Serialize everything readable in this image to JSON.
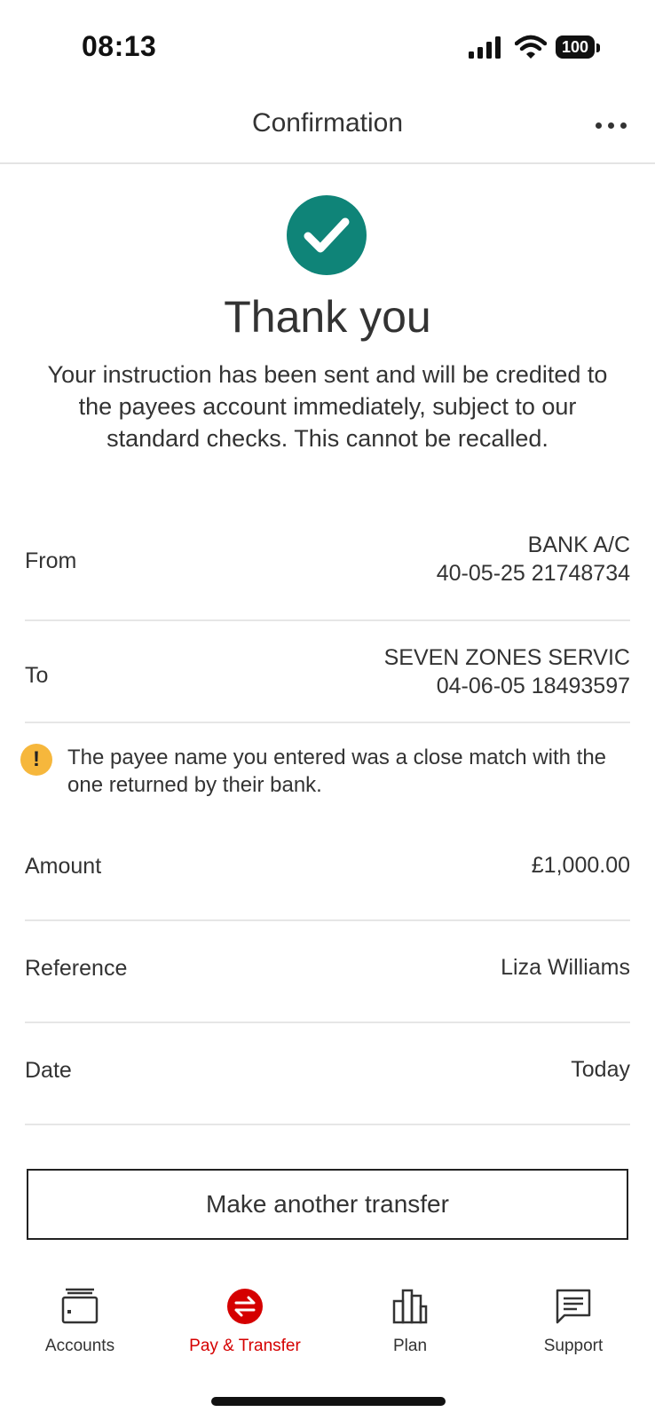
{
  "status_bar": {
    "time": "08:13",
    "battery": "100"
  },
  "header": {
    "title": "Confirmation"
  },
  "success": {
    "title": "Thank you",
    "message": "Your instruction has been sent and will be credited to the payees account immediately, subject to our standard checks.  This cannot be recalled."
  },
  "details": {
    "from": {
      "label": "From",
      "line1": "BANK A/C",
      "line2": "40-05-25 21748734"
    },
    "to": {
      "label": "To",
      "line1": "SEVEN ZONES SERVIC",
      "line2": "04-06-05 18493597"
    },
    "warning": {
      "icon": "!",
      "text": "The payee name you entered was a close match with the one returned by their bank."
    },
    "amount": {
      "label": "Amount",
      "value": "£1,000.00"
    },
    "reference": {
      "label": "Reference",
      "value": "Liza Williams"
    },
    "date": {
      "label": "Date",
      "value": "Today"
    }
  },
  "actions": {
    "another_transfer": "Make another transfer"
  },
  "nav": {
    "items": [
      {
        "label": "Accounts",
        "icon": "wallet-icon"
      },
      {
        "label": "Pay & Transfer",
        "icon": "transfer-icon",
        "active": true
      },
      {
        "label": "Plan",
        "icon": "bar-chart-icon"
      },
      {
        "label": "Support",
        "icon": "chat-icon"
      }
    ]
  },
  "colors": {
    "success": "#0f8478",
    "warning": "#f6b73c",
    "active_nav": "#d50000"
  }
}
